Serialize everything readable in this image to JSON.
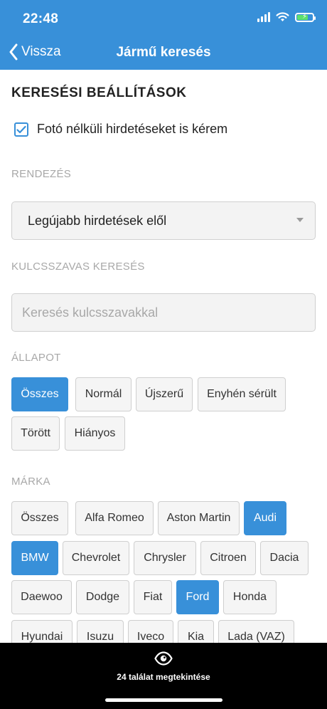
{
  "status_bar": {
    "time": "22:48"
  },
  "nav": {
    "back_label": "Vissza",
    "title": "Jármű keresés"
  },
  "settings": {
    "title": "KERESÉSI BEÁLLÍTÁSOK",
    "photo_checkbox": {
      "label": "Fotó nélküli hirdetéseket is kérem",
      "checked": true
    }
  },
  "sort": {
    "label": "RENDEZÉS",
    "selected": "Legújabb hirdetések elől"
  },
  "keyword": {
    "label": "KULCSSZAVAS KERESÉS",
    "placeholder": "Keresés kulcsszavakkal",
    "value": ""
  },
  "condition": {
    "label": "ÁLLAPOT",
    "options": [
      {
        "label": "Összes",
        "active": true
      },
      {
        "label": "Normál",
        "active": false
      },
      {
        "label": "Újszerű",
        "active": false
      },
      {
        "label": "Enyhén sérült",
        "active": false
      },
      {
        "label": "Törött",
        "active": false
      },
      {
        "label": "Hiányos",
        "active": false
      }
    ]
  },
  "brand": {
    "label": "MÁRKA",
    "options": [
      {
        "label": "Összes",
        "active": false
      },
      {
        "label": "Alfa Romeo",
        "active": false
      },
      {
        "label": "Aston Martin",
        "active": false
      },
      {
        "label": "Audi",
        "active": true
      },
      {
        "label": "BMW",
        "active": true
      },
      {
        "label": "Chevrolet",
        "active": false
      },
      {
        "label": "Chrysler",
        "active": false
      },
      {
        "label": "Citroen",
        "active": false
      },
      {
        "label": "Dacia",
        "active": false
      },
      {
        "label": "Daewoo",
        "active": false
      },
      {
        "label": "Dodge",
        "active": false
      },
      {
        "label": "Fiat",
        "active": false
      },
      {
        "label": "Ford",
        "active": true
      },
      {
        "label": "Honda",
        "active": false
      },
      {
        "label": "Hyundai",
        "active": false
      },
      {
        "label": "Isuzu",
        "active": false
      },
      {
        "label": "Iveco",
        "active": false
      },
      {
        "label": "Kia",
        "active": false
      },
      {
        "label": "Lada (VAZ)",
        "active": false
      }
    ]
  },
  "results_bar": {
    "label": "24 találat megtekintése",
    "icon": "eye-icon"
  },
  "colors": {
    "accent": "#3890d9",
    "bottom_bar": "#000000",
    "label_gray": "#a8a8a8"
  }
}
